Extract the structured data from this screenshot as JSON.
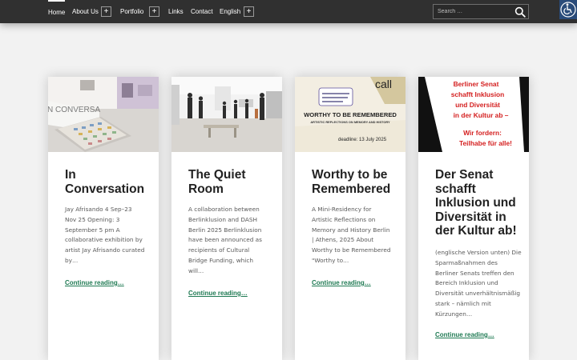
{
  "nav": {
    "items": [
      {
        "label": "Home"
      },
      {
        "label": "About Us"
      },
      {
        "label": "Portfolio"
      },
      {
        "label": "Links"
      },
      {
        "label": "Contact"
      },
      {
        "label": "English"
      }
    ],
    "expand_symbol": "+"
  },
  "search": {
    "placeholder": "Search …"
  },
  "colors": {
    "nav_background": "#303030",
    "link": "#1f7a53",
    "page_background": "#f2f2f2",
    "accessibility_button": "#2a4c7a"
  },
  "icons": {
    "search": "magnifier",
    "accessibility": "wheelchair"
  },
  "cards": [
    {
      "title": "In Conversation",
      "excerpt": "Jay Afrisando 4 Sep–23 Nov 25 Opening: 3 September 5 pm A collaborative exhibition by artist Jay Afrisando curated by…",
      "link": "Continue reading…",
      "image_text": "N CONVERSA"
    },
    {
      "title": "The Quiet Room",
      "excerpt": "A collaboration between Berlinklusion and DASH Berlin 2025 Berlinklusion have been announced as recipients of Cultural Bridge Funding, which will…",
      "link": "Continue reading…"
    },
    {
      "title": "Worthy to be Remembered",
      "excerpt": "A Mini-Residency for Artistic Reflections on Memory and History Berlin | Athens, 2025 About Worthy to be Remembered \"Worthy to…",
      "link": "Continue reading…",
      "image_text": {
        "call": "call",
        "heading": "WORTHY TO BE REMEMBERED",
        "subheading": "ARTISTIC REFLECTIONS ON MEMORY AND HISTORY",
        "deadline": "deadline: 13 July 2025"
      }
    },
    {
      "title": "Der Senat schafft Inklusion und Diversität in der Kultur ab!",
      "excerpt": "(englische Version unten) Die Sparmaßnahmen des Berliner Senats treffen den Bereich Inklusion und Diversität unverhältnismäßig stark – nämlich mit Kürzungen…",
      "link": "Continue reading…",
      "image_text": {
        "line1": "Berliner Senat",
        "line2": "schafft Inklusion",
        "line3": "und Diversität",
        "line4": "in der Kultur ab –",
        "line5": "Wir fordern:",
        "line6": "Teilhabe für alle!"
      }
    }
  ]
}
